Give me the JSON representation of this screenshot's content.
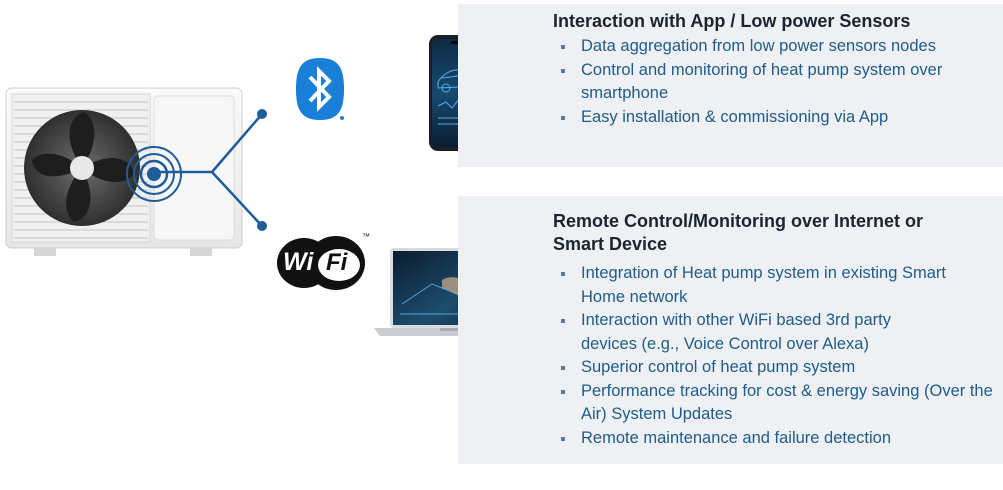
{
  "section1": {
    "title": "Interaction with App / Low power Sensors",
    "bullets": [
      "Data aggregation from low power sensors nodes",
      "Control and monitoring of heat pump system over smartphone",
      "Easy installation & commissioning via App"
    ]
  },
  "section2": {
    "title": "Remote Control/Monitoring over Internet or Smart Device",
    "bullets": [
      "Integration of Heat pump system in existing Smart Home network",
      "Interaction with other WiFi based 3rd party devices (e.g., Voice Control over Alexa)",
      "Superior control of heat pump system",
      "Performance tracking for cost & energy saving (Over the Air) System Updates",
      "Remote maintenance and failure detection"
    ]
  },
  "wifi_logo": {
    "left": "Wi",
    "right": "Fi",
    "tm": "™"
  },
  "colors": {
    "accent": "#1f5c8a",
    "bluetooth": "#1a7fd6",
    "line": "#1f5c9a",
    "panel": "#eef0f3"
  },
  "icons": [
    "heat-pump-unit",
    "signal-waves-icon",
    "bluetooth-logo",
    "wifi-logo",
    "smartphone",
    "laptop"
  ]
}
